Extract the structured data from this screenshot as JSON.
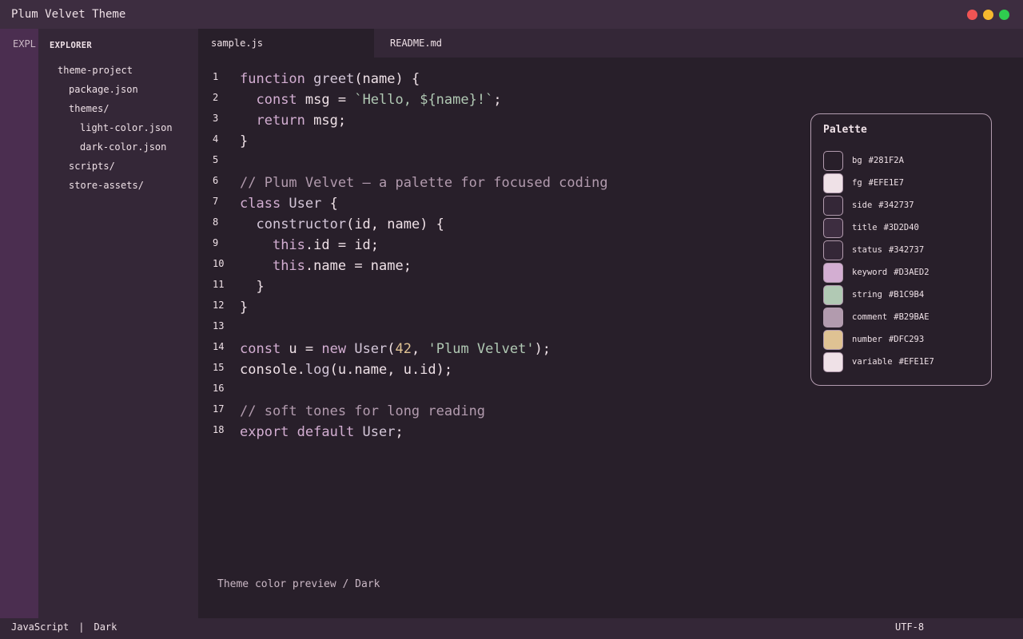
{
  "window": {
    "title": "Plum Velvet Theme",
    "buttons": [
      {
        "name": "close",
        "color": "#F05454"
      },
      {
        "name": "minimize",
        "color": "#F5B82E"
      },
      {
        "name": "maximize",
        "color": "#2FCB4F"
      }
    ]
  },
  "activitybar": {
    "label": "EXPL"
  },
  "sidebar": {
    "header": "EXPLORER",
    "items": [
      {
        "label": "theme-project",
        "depth": 0
      },
      {
        "label": "package.json",
        "depth": 1
      },
      {
        "label": "themes/",
        "depth": 1
      },
      {
        "label": "light-color.json",
        "depth": 2
      },
      {
        "label": "dark-color.json",
        "depth": 2
      },
      {
        "label": "scripts/",
        "depth": 1
      },
      {
        "label": "store-assets/",
        "depth": 1
      }
    ]
  },
  "tabs": [
    {
      "label": "sample.js",
      "active": true
    },
    {
      "label": "README.md",
      "active": false
    }
  ],
  "editor": {
    "lines": [
      {
        "n": "1",
        "tokens": [
          [
            "keyword",
            "function "
          ],
          [
            "fn",
            "greet"
          ],
          [
            "plain",
            "(name) {"
          ]
        ]
      },
      {
        "n": "2",
        "tokens": [
          [
            "plain",
            "  "
          ],
          [
            "keyword",
            "const "
          ],
          [
            "plain",
            "msg = "
          ],
          [
            "string",
            "`Hello, ${name}!`"
          ],
          [
            "plain",
            ";"
          ]
        ]
      },
      {
        "n": "3",
        "tokens": [
          [
            "plain",
            "  "
          ],
          [
            "keyword",
            "return "
          ],
          [
            "plain",
            "msg;"
          ]
        ]
      },
      {
        "n": "4",
        "tokens": [
          [
            "plain",
            "}"
          ]
        ]
      },
      {
        "n": "5",
        "tokens": []
      },
      {
        "n": "6",
        "tokens": [
          [
            "comment",
            "// Plum Velvet — a palette for focused coding"
          ]
        ]
      },
      {
        "n": "7",
        "tokens": [
          [
            "keyword",
            "class "
          ],
          [
            "fn",
            "User"
          ],
          [
            "plain",
            " {"
          ]
        ]
      },
      {
        "n": "8",
        "tokens": [
          [
            "plain",
            "  "
          ],
          [
            "fn",
            "constructor"
          ],
          [
            "plain",
            "(id, name) {"
          ]
        ]
      },
      {
        "n": "9",
        "tokens": [
          [
            "plain",
            "    "
          ],
          [
            "keyword",
            "this"
          ],
          [
            "plain",
            ".id = id;"
          ]
        ]
      },
      {
        "n": "10",
        "tokens": [
          [
            "plain",
            "    "
          ],
          [
            "keyword",
            "this"
          ],
          [
            "plain",
            ".name = name;"
          ]
        ]
      },
      {
        "n": "11",
        "tokens": [
          [
            "plain",
            "  }"
          ]
        ]
      },
      {
        "n": "12",
        "tokens": [
          [
            "plain",
            "}"
          ]
        ]
      },
      {
        "n": "13",
        "tokens": []
      },
      {
        "n": "14",
        "tokens": [
          [
            "keyword",
            "const "
          ],
          [
            "plain",
            "u = "
          ],
          [
            "keyword",
            "new "
          ],
          [
            "fn",
            "User"
          ],
          [
            "plain",
            "("
          ],
          [
            "number",
            "42"
          ],
          [
            "plain",
            ", "
          ],
          [
            "string",
            "'Plum Velvet'"
          ],
          [
            "plain",
            ");"
          ]
        ]
      },
      {
        "n": "15",
        "tokens": [
          [
            "plain",
            "console."
          ],
          [
            "fn",
            "log"
          ],
          [
            "plain",
            "(u.name, u.id);"
          ]
        ]
      },
      {
        "n": "16",
        "tokens": []
      },
      {
        "n": "17",
        "tokens": [
          [
            "comment",
            "// soft tones for long reading"
          ]
        ]
      },
      {
        "n": "18",
        "tokens": [
          [
            "keyword",
            "export default "
          ],
          [
            "fn",
            "User"
          ],
          [
            "plain",
            ";"
          ]
        ]
      }
    ]
  },
  "palette": {
    "title": "Palette",
    "entries": [
      {
        "name": "bg",
        "hex": "#281F2A"
      },
      {
        "name": "fg",
        "hex": "#EFE1E7"
      },
      {
        "name": "side",
        "hex": "#342737"
      },
      {
        "name": "title",
        "hex": "#3D2D40"
      },
      {
        "name": "status",
        "hex": "#342737"
      },
      {
        "name": "keyword",
        "hex": "#D3AED2"
      },
      {
        "name": "string",
        "hex": "#B1C9B4"
      },
      {
        "name": "comment",
        "hex": "#B29BAE"
      },
      {
        "name": "number",
        "hex": "#DFC293"
      },
      {
        "name": "variable",
        "hex": "#EFE1E7"
      }
    ]
  },
  "preview_label": "Theme color preview / Dark",
  "statusbar": {
    "language": "JavaScript",
    "separator": "|",
    "theme": "Dark",
    "encoding": "UTF-8"
  }
}
